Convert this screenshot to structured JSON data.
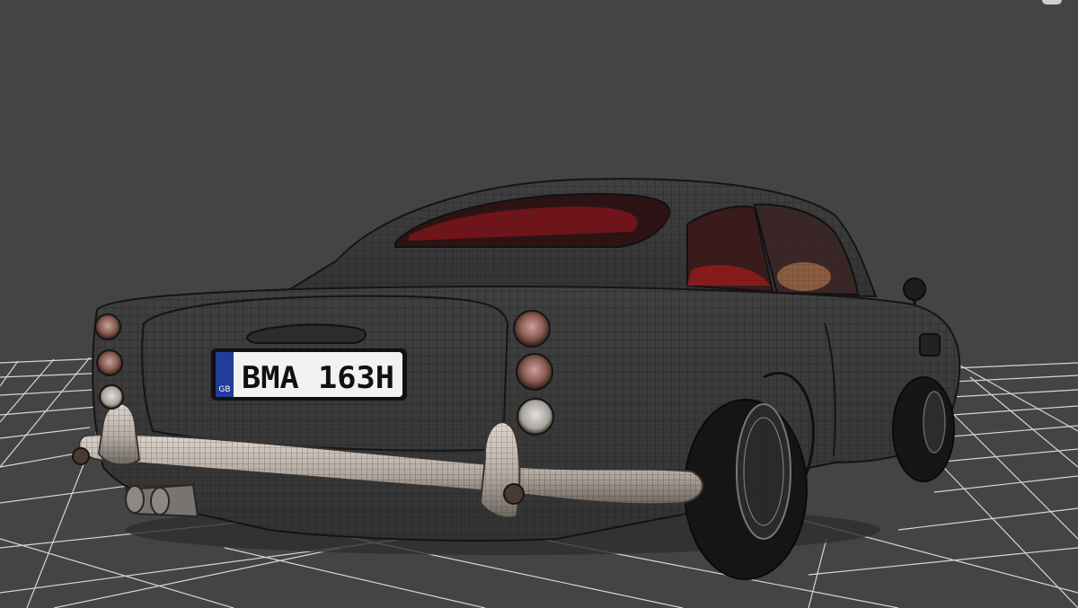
{
  "viewport": {
    "background": "#444444",
    "grid_color": "#d8d8d8",
    "icon": "3d-viewport-corner-marker"
  },
  "car": {
    "body_color": "#3b3b3b",
    "wire_color": "#1a1a1a",
    "chrome_color": "#c9c0b8",
    "interior_color": "#8a1a1c",
    "plate": {
      "country_code": "GB",
      "text": "BMA 163H",
      "band_color": "#1f3d99",
      "plate_color": "#f2f2f2"
    }
  }
}
